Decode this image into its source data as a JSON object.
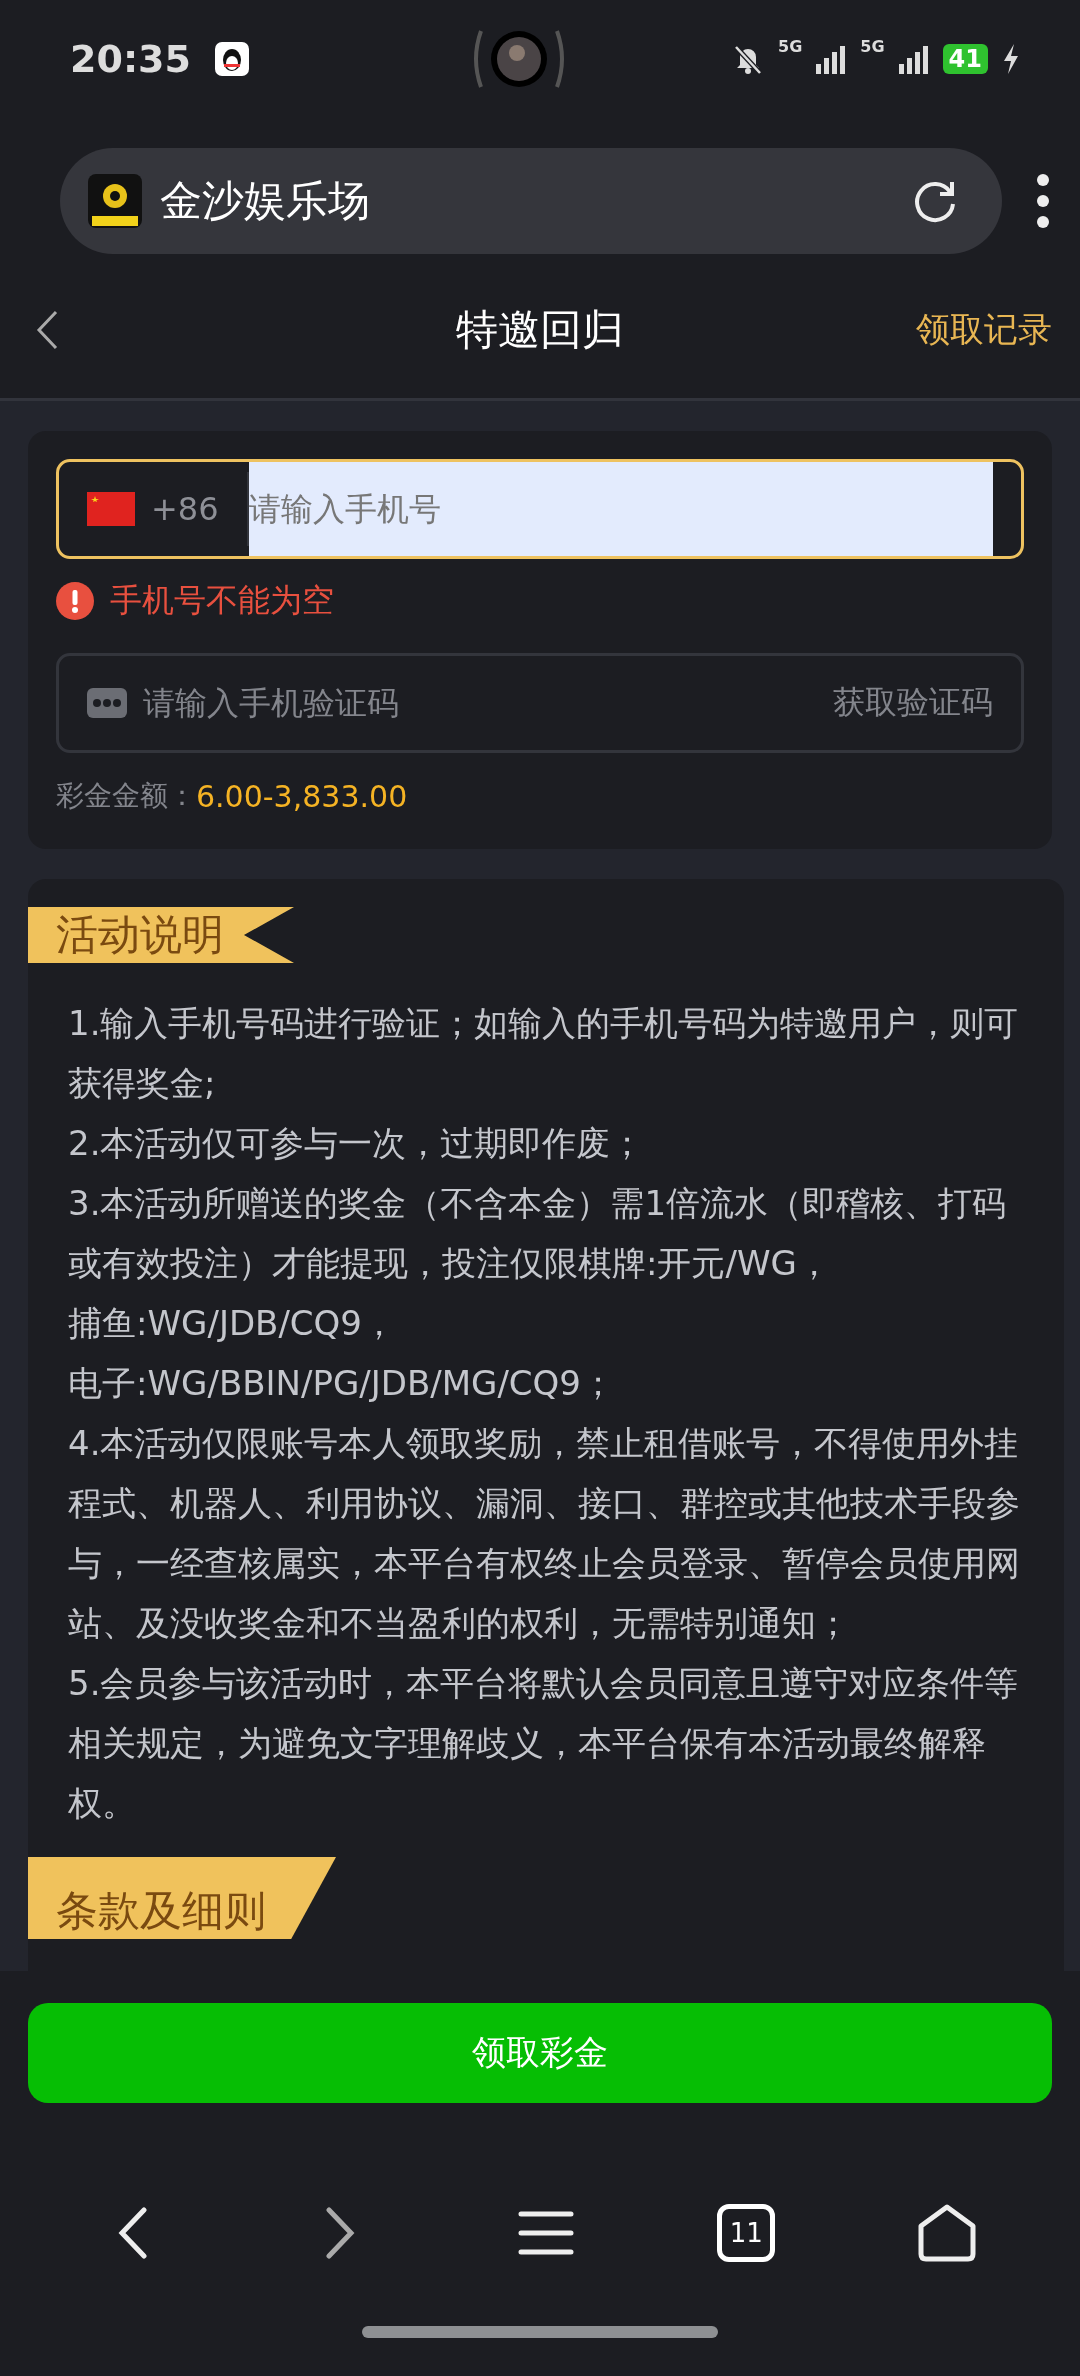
{
  "status_bar": {
    "time": "20:35",
    "network_1": "5G",
    "network_2": "5G",
    "battery": "41"
  },
  "browser": {
    "site_title": "金沙娱乐场"
  },
  "header": {
    "title": "特邀回归",
    "action": "领取记录"
  },
  "form": {
    "country_code": "+86",
    "phone_placeholder": "请输入手机号",
    "error": "手机号不能为空",
    "code_placeholder": "请输入手机验证码",
    "code_button": "获取验证码",
    "amount_label": "彩金金额：",
    "amount_value": "6.00-3,833.00"
  },
  "activity": {
    "heading": "活动说明",
    "items": [
      "1.输入手机号码进行验证；如输入的手机号码为特邀用户，则可获得奖金;",
      "2.本活动仅可参与一次，过期即作废；",
      "3.本活动所赠送的奖金（不含本金）需1倍流水（即稽核、打码或有效投注）才能提现，投注仅限棋牌:开元/WG，",
      "捕鱼:WG/JDB/CQ9，",
      "电子:WG/BBIN/PG/JDB/MG/CQ9；",
      "4.本活动仅限账号本人领取奖励，禁止租借账号，不得使用外挂程式、机器人、利用协议、漏洞、接口、群控或其他技术手段参与，一经查核属实，本平台有权终止会员登录、暂停会员使用网站、及没收奖金和不当盈利的权利，无需特别通知；",
      "5.会员参与该活动时，本平台将默认会员同意且遵守对应条件等相关规定，为避免文字理解歧义，本平台保有本活动最终解释权。"
    ],
    "next_heading": "条款及细则"
  },
  "submit": "领取彩金",
  "nav": {
    "tab_count": "11"
  }
}
